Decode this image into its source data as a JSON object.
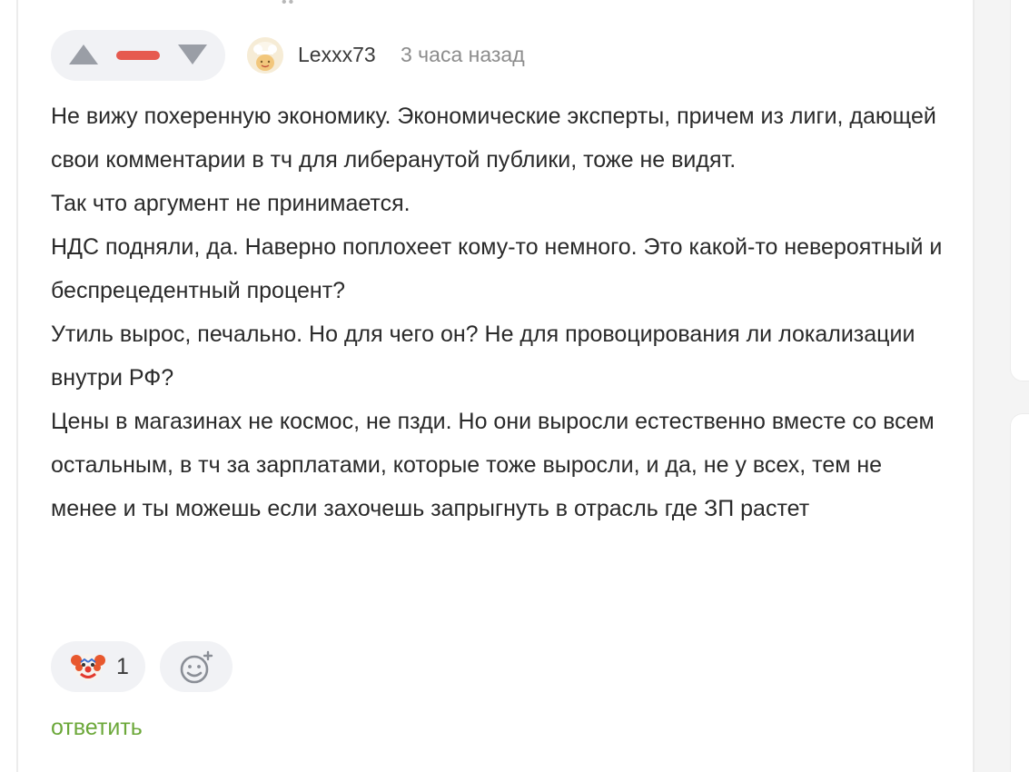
{
  "comment": {
    "author": "Lexxx73",
    "time": "3 часа назад",
    "vote": {
      "up_icon": "triangle-up-icon",
      "down_icon": "triangle-down-icon",
      "rating_indicator_color": "#e65a4f"
    },
    "paragraphs": [
      "Не вижу похеренную экономику. Экономические эксперты, причем из лиги, дающей свои комментарии в тч для либеранутой публики, тоже не видят.",
      "Так что аргумент не принимается.",
      "НДС подняли, да. Наверно поплохеет кому-то немного. Это какой-то невероятный и беспрецедентный процент?",
      "Утиль вырос, печально. Но для чего он? Не для провоцирования ли локализации внутри РФ?",
      "Цены в магазинах не космос, не пзди. Но они выросли естественно вместе со всем остальным, в тч за зарплатами, которые тоже выросли, и да, не у всех, тем не менее и ты можешь если захочешь запрыгнуть в отрасль где ЗП растет"
    ],
    "reactions": [
      {
        "icon": "clown-face-icon",
        "count": "1"
      }
    ],
    "add_reaction_icon": "add-reaction-smiley-icon",
    "reply_label": "ответить"
  },
  "colors": {
    "accent_green": "#6ca83a",
    "pill_background": "#f1f2f5",
    "muted_text": "#8c8c8c"
  }
}
